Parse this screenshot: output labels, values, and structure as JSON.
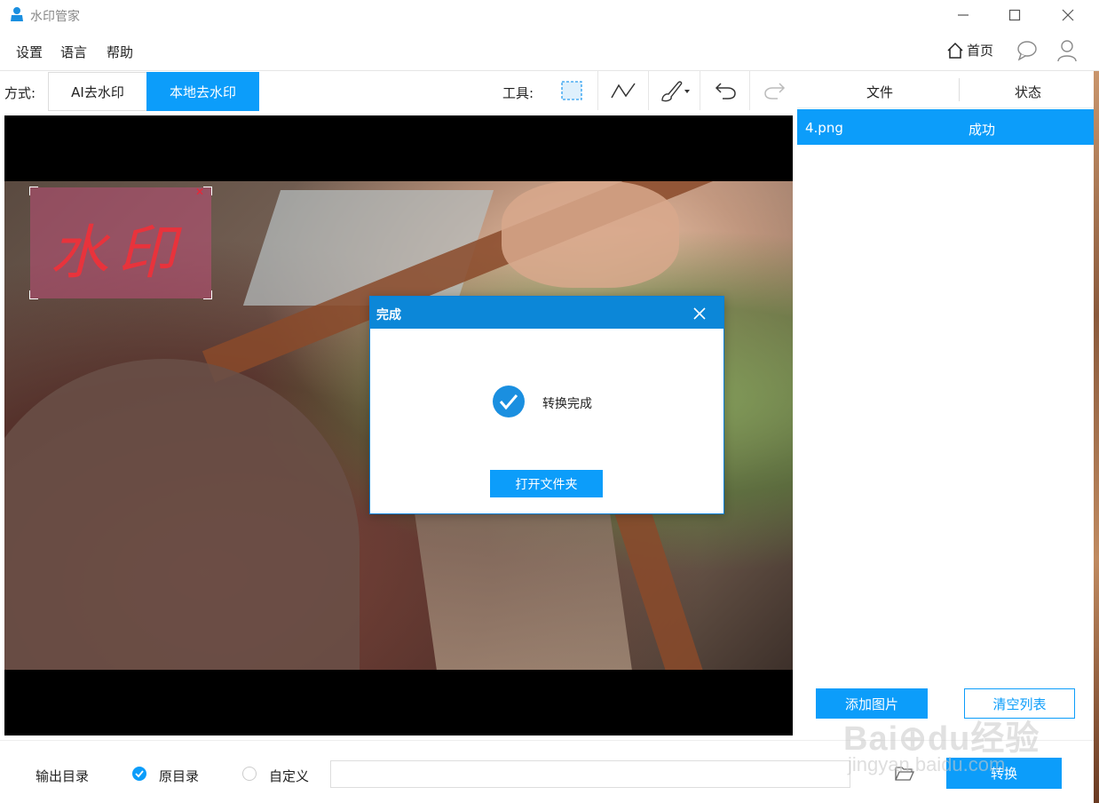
{
  "window": {
    "title": "水印管家"
  },
  "menu": {
    "settings": "设置",
    "language": "语言",
    "help": "帮助",
    "home": "首页"
  },
  "mode": {
    "label": "方式:",
    "ai": "AI去水印",
    "local": "本地去水印"
  },
  "tools": {
    "label": "工具:"
  },
  "file_list": {
    "col_file": "文件",
    "col_status": "状态",
    "rows": [
      {
        "name": "4.png",
        "status": "成功"
      }
    ]
  },
  "buttons": {
    "add_image": "添加图片",
    "clear_list": "清空列表",
    "convert": "转换"
  },
  "dialog": {
    "title": "完成",
    "message": "转换完成",
    "open_folder": "打开文件夹"
  },
  "watermark_region": {
    "text": "水印"
  },
  "output": {
    "label": "输出目录",
    "original": "原目录",
    "custom": "自定义",
    "path_value": "",
    "selected": "原目录"
  },
  "overlay": {
    "brand": "Bai⊕du经验",
    "url": "jingyan.baidu.com"
  },
  "colors": {
    "accent": "#0c9dfa",
    "dialog_header": "#0c87d8",
    "selection": "#be5078"
  }
}
